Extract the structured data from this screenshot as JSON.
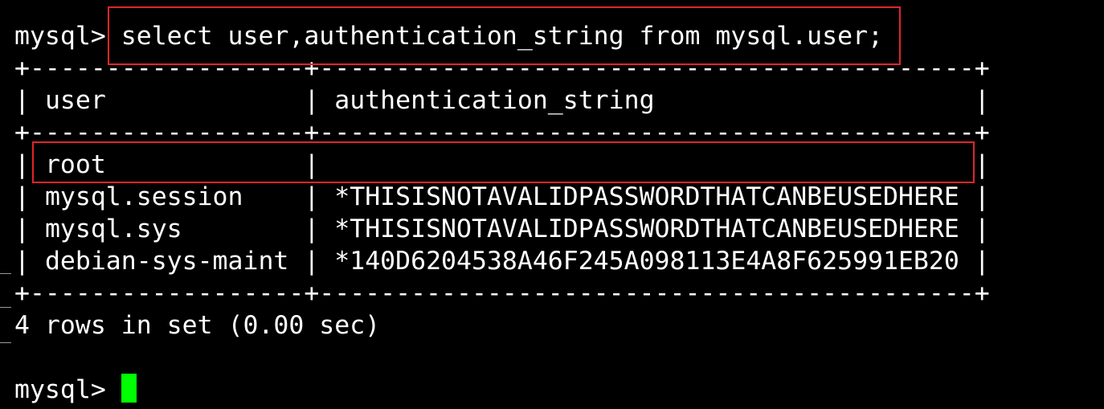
{
  "terminal": {
    "prompt": "mysql> ",
    "command": "select user,authentication_string from mysql.user;",
    "border_line": "+------------------+-------------------------------------------+",
    "header": {
      "col1": "user",
      "col2": "authentication_string"
    },
    "rows": [
      {
        "user": "root",
        "authentication_string": ""
      },
      {
        "user": "mysql.session",
        "authentication_string": "*THISISNOTAVALIDPASSWORDTHATCANBEUSEDHERE"
      },
      {
        "user": "mysql.sys",
        "authentication_string": "*THISISNOTAVALIDPASSWORDTHATCANBEUSEDHERE"
      },
      {
        "user": "debian-sys-maint",
        "authentication_string": "*140D6204538A46F245A098113E4A8F625991EB20"
      }
    ],
    "status": "4 rows in set (0.00 sec)",
    "cursor_color": "#00ff00",
    "highlight_color": "#e0252b"
  }
}
